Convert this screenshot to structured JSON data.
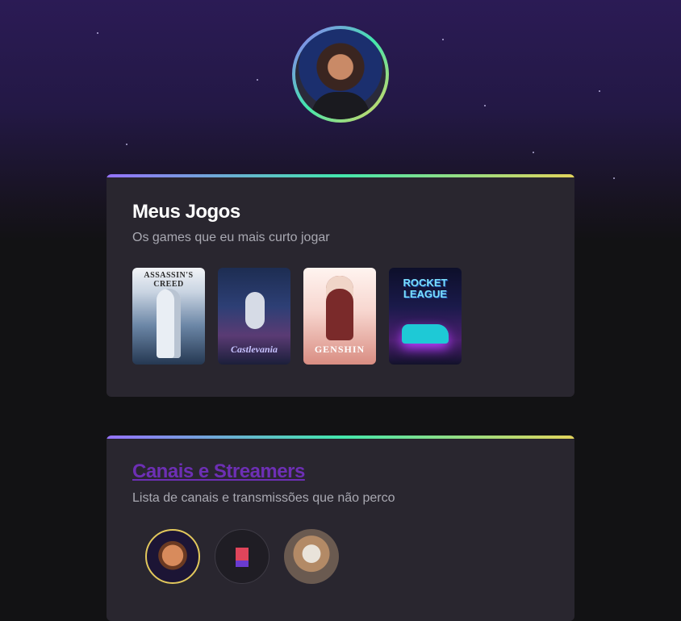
{
  "profile": {
    "avatar_alt": "Foto de perfil"
  },
  "games_section": {
    "title": "Meus Jogos",
    "subtitle": "Os games que eu mais curto jogar",
    "games": [
      {
        "title": "ASSASSIN'S CREED"
      },
      {
        "title": "Castlevania"
      },
      {
        "title": "GENSHIN"
      },
      {
        "title": "ROCKET LEAGUE"
      }
    ]
  },
  "channels_section": {
    "title": "Canais e Streamers",
    "subtitle": "Lista de canais e transmissões que não perco"
  },
  "colors": {
    "accent_gradient": [
      "#9572fc",
      "#43e7ad",
      "#e2d45c"
    ],
    "card_bg": "#29262f",
    "page_bg": "#121214",
    "link_visited": "#6d2fb4"
  }
}
